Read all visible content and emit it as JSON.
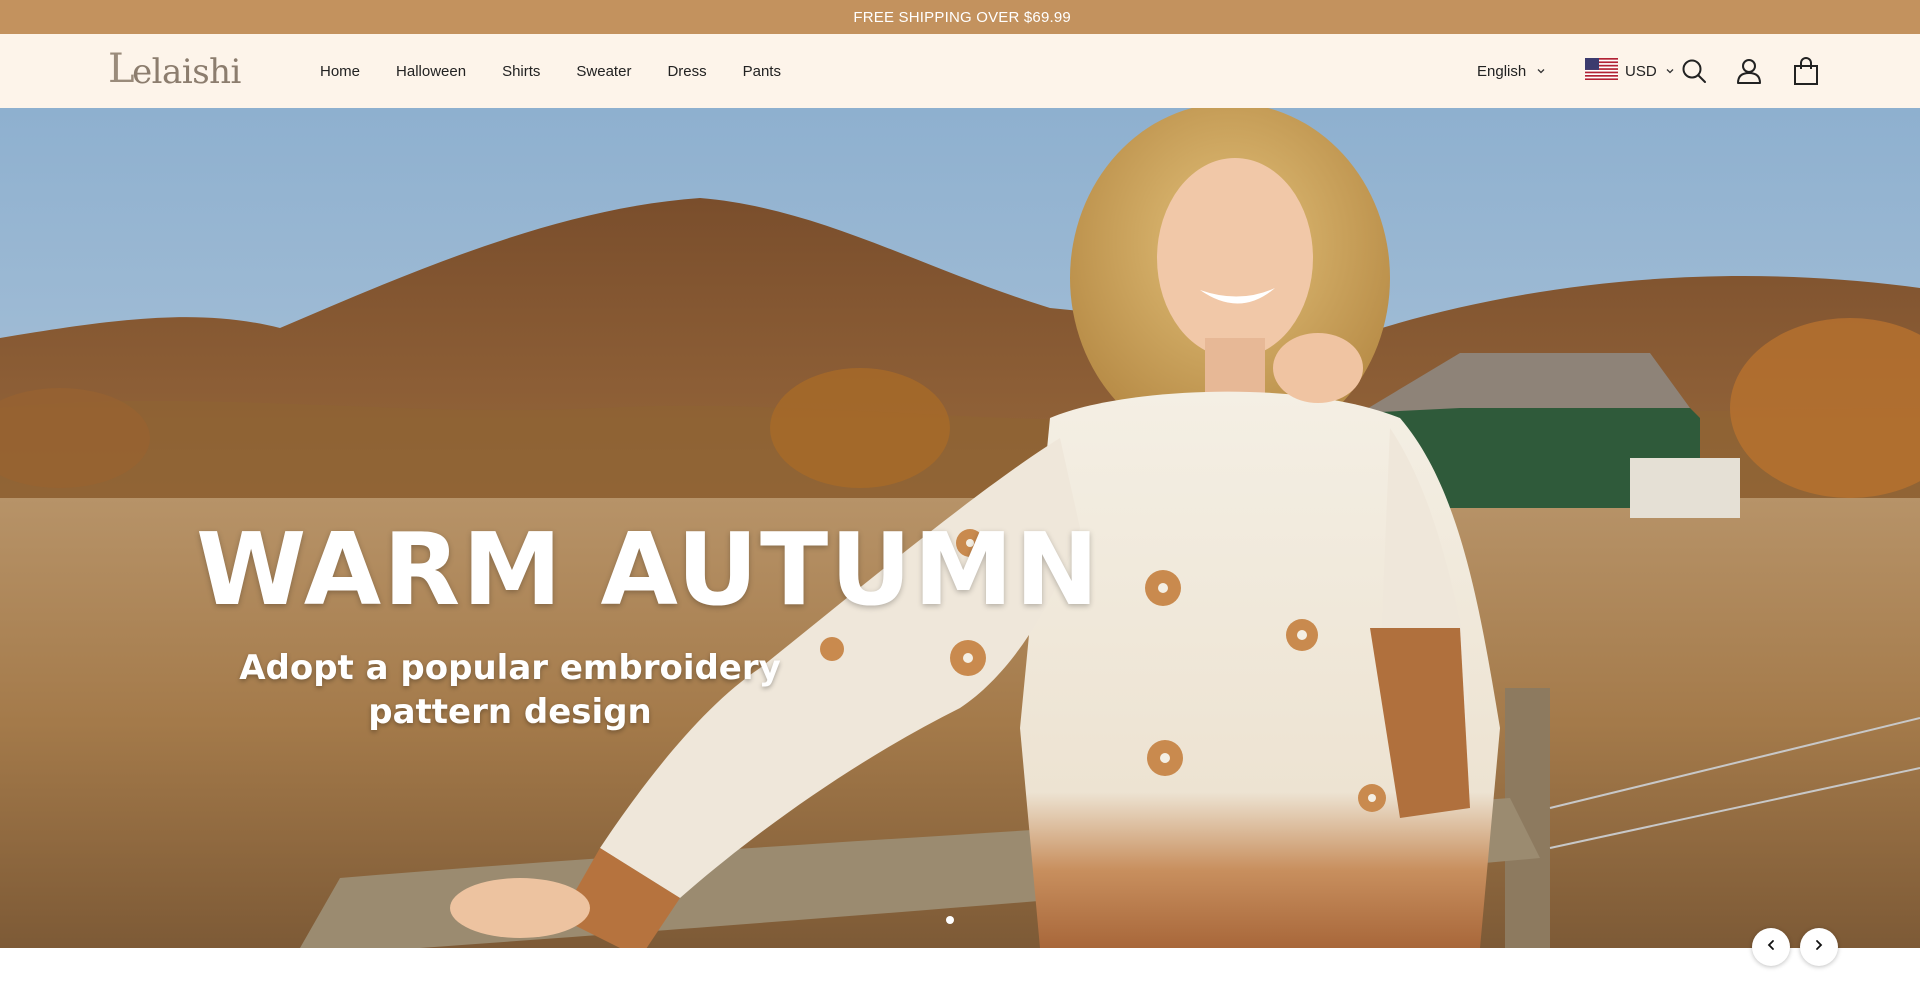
{
  "announcement": {
    "text": " FREE SHIPPING OVER $69.99"
  },
  "header": {
    "logo_text": "elaishi",
    "logo_mark": "L",
    "nav": [
      {
        "label": "Home"
      },
      {
        "label": "Halloween"
      },
      {
        "label": "Shirts"
      },
      {
        "label": "Sweater"
      },
      {
        "label": "Dress"
      },
      {
        "label": "Pants"
      }
    ],
    "language": "English",
    "currency": "USD",
    "icons": [
      "chevron-down-icon",
      "us-flag-icon",
      "search-icon",
      "account-icon",
      "cart-icon"
    ]
  },
  "hero": {
    "title": "WARM AUTUMN",
    "subtitle": "Adopt a popular embroidery pattern design",
    "slide_count": 1,
    "active_slide": 1
  },
  "colors": {
    "announcement_bg": "#c3925e",
    "header_bg": "#fdf4ea",
    "hero_text": "#ffffff"
  }
}
